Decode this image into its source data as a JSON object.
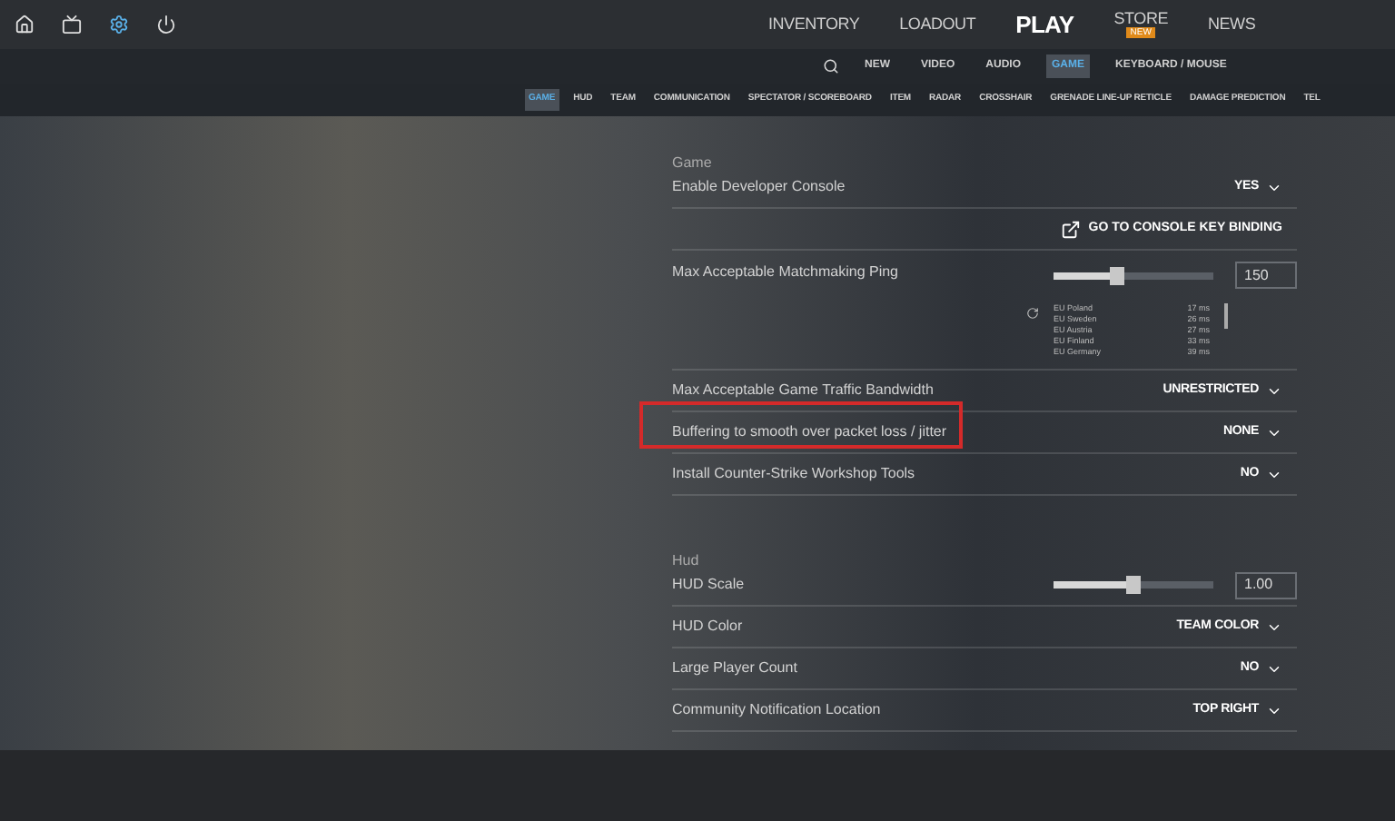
{
  "top_icons": [
    {
      "kind": "home",
      "selected": false
    },
    {
      "kind": "tv",
      "selected": false
    },
    {
      "kind": "gear",
      "selected": true
    },
    {
      "kind": "power",
      "selected": false
    }
  ],
  "main_nav": [
    {
      "label": "INVENTORY",
      "selected": false
    },
    {
      "label": "LOADOUT",
      "selected": false
    },
    {
      "label": "PLAY",
      "selected": true
    },
    {
      "label": "STORE",
      "selected": false,
      "badge": "NEW"
    },
    {
      "label": "NEWS",
      "selected": false
    }
  ],
  "settings_tabs": [
    {
      "label": "NEW",
      "selected": false
    },
    {
      "label": "VIDEO",
      "selected": false
    },
    {
      "label": "AUDIO",
      "selected": false
    },
    {
      "label": "GAME",
      "selected": true
    },
    {
      "label": "KEYBOARD / MOUSE",
      "selected": false
    }
  ],
  "sub_tabs": [
    {
      "label": "GAME",
      "selected": true
    },
    {
      "label": "HUD",
      "selected": false
    },
    {
      "label": "TEAM",
      "selected": false
    },
    {
      "label": "COMMUNICATION",
      "selected": false
    },
    {
      "label": "SPECTATOR / SCOREBOARD",
      "selected": false
    },
    {
      "label": "ITEM",
      "selected": false
    },
    {
      "label": "RADAR",
      "selected": false
    },
    {
      "label": "CROSSHAIR",
      "selected": false
    },
    {
      "label": "GRENADE LINE-UP RETICLE",
      "selected": false
    },
    {
      "label": "DAMAGE PREDICTION",
      "selected": false
    },
    {
      "label": "TEL",
      "selected": false
    }
  ],
  "sections": [
    {
      "title": "Game",
      "rows": [
        {
          "kind": "dropdown",
          "label": "Enable Developer Console",
          "value": "YES",
          "highlighted": false
        },
        {
          "kind": "link",
          "label": "GO TO CONSOLE KEY BINDING"
        },
        {
          "kind": "ping",
          "label": "Max Acceptable Matchmaking Ping",
          "level": 0.4,
          "value": "150",
          "servers": [
            {
              "name": "EU Poland",
              "ping": "17 ms"
            },
            {
              "name": "EU Sweden",
              "ping": "26 ms"
            },
            {
              "name": "EU Austria",
              "ping": "27 ms"
            },
            {
              "name": "EU Finland",
              "ping": "33 ms"
            },
            {
              "name": "EU Germany",
              "ping": "39 ms"
            }
          ]
        },
        {
          "kind": "dropdown",
          "label": "Max Acceptable Game Traffic Bandwidth",
          "value": "UNRESTRICTED",
          "highlighted": false
        },
        {
          "kind": "dropdown",
          "label": "Buffering to smooth over packet loss / jitter",
          "value": "NONE",
          "highlighted": true
        },
        {
          "kind": "dropdown",
          "label": "Install Counter-Strike Workshop Tools",
          "value": "NO",
          "highlighted": false
        }
      ]
    },
    {
      "title": "Hud",
      "rows": [
        {
          "kind": "slider",
          "label": "HUD Scale",
          "level": 0.5,
          "value": "1.00"
        },
        {
          "kind": "dropdown",
          "label": "HUD Color",
          "value": "TEAM COLOR",
          "highlighted": false
        },
        {
          "kind": "dropdown",
          "label": "Large Player Count",
          "value": "NO",
          "highlighted": false
        },
        {
          "kind": "dropdown",
          "label": "Community Notification Location",
          "value": "TOP RIGHT",
          "highlighted": false
        }
      ]
    }
  ]
}
